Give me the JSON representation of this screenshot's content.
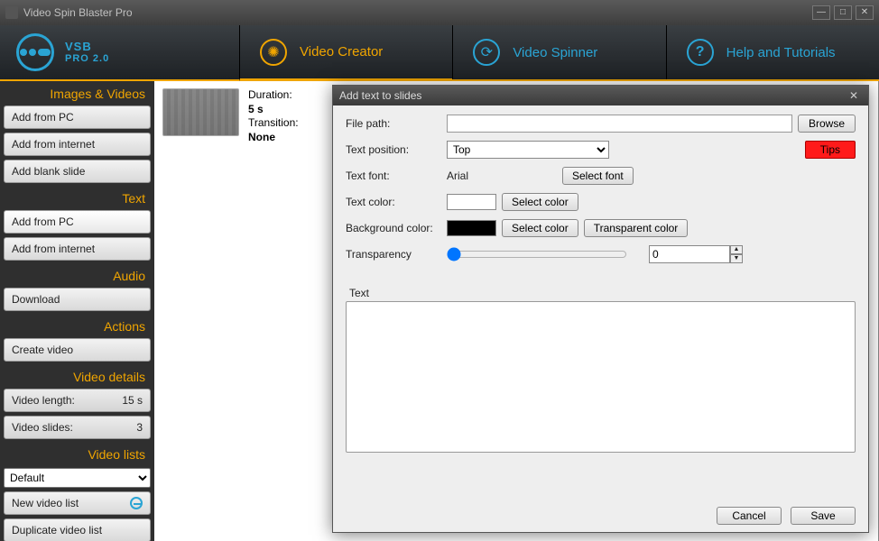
{
  "window": {
    "title": "Video Spin Blaster Pro"
  },
  "logo": {
    "line1": "VSB",
    "line2": "PRO 2.0"
  },
  "nav": {
    "video_creator": "Video Creator",
    "video_spinner": "Video Spinner",
    "help": "Help and Tutorials"
  },
  "sidebar": {
    "images_head": "Images & Videos",
    "img_pc": "Add from PC",
    "img_net": "Add from internet",
    "img_blank": "Add blank slide",
    "text_head": "Text",
    "txt_pc": "Add from PC",
    "txt_net": "Add from internet",
    "audio_head": "Audio",
    "audio_dl": "Download",
    "actions_head": "Actions",
    "act_create": "Create video",
    "details_head": "Video details",
    "len_label": "Video length:",
    "len_val": "15 s",
    "slides_label": "Video slides:",
    "slides_val": "3",
    "lists_head": "Video lists",
    "list_default": "Default",
    "list_new": "New video list",
    "list_dupe": "Duplicate video list"
  },
  "slide": {
    "dur_label": "Duration:",
    "dur_val": "5 s",
    "trans_label": "Transition:",
    "trans_val": "None"
  },
  "dialog": {
    "title": "Add text to slides",
    "file_path": "File path:",
    "browse": "Browse",
    "text_pos": "Text position:",
    "pos_val": "Top",
    "tips": "Tips",
    "text_font": "Text font:",
    "font_val": "Arial",
    "select_font": "Select font",
    "text_color": "Text color:",
    "select_color": "Select color",
    "bg_color": "Background color:",
    "transp_color": "Transparent color",
    "transparency": "Transparency",
    "transp_val": "0",
    "text_label": "Text",
    "cancel": "Cancel",
    "save": "Save"
  },
  "colors": {
    "text": "#ffffff",
    "bg": "#000000"
  }
}
